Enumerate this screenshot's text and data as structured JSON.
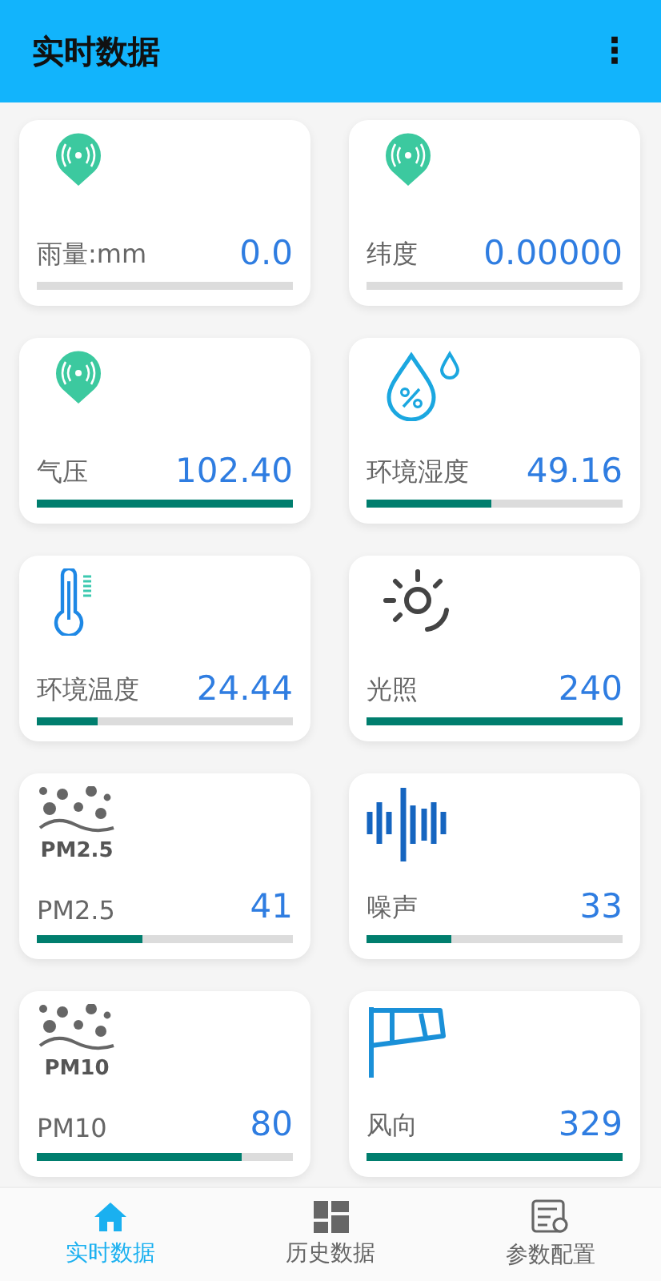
{
  "app_bar": {
    "title": "实时数据",
    "menu_icon": "⋮"
  },
  "cards": [
    {
      "kind": "pin",
      "label": "雨量:mm",
      "value": "0.0",
      "level": 0
    },
    {
      "kind": "pin",
      "label": "纬度",
      "value": "0.00000",
      "level": 0
    },
    {
      "kind": "pin",
      "label": "气压",
      "value": "102.40",
      "level": 1
    },
    {
      "kind": "humidity",
      "label": "环境湿度",
      "value": "49.16",
      "level": 0.49
    },
    {
      "kind": "thermometer",
      "label": "环境温度",
      "value": "24.44",
      "level": 0.24
    },
    {
      "kind": "sun",
      "label": "光照",
      "value": "240",
      "level": 1
    },
    {
      "kind": "particles",
      "icon_text": "PM2.5",
      "label": "PM2.5",
      "value": "41",
      "level": 0.41
    },
    {
      "kind": "sound",
      "label": "噪声",
      "value": "33",
      "level": 0.33
    },
    {
      "kind": "particles",
      "icon_text": "PM10",
      "label": "PM10",
      "value": "80",
      "level": 0.8
    },
    {
      "kind": "flag",
      "label": "风向",
      "value": "329",
      "level": 1
    }
  ],
  "bottom_nav": [
    {
      "kind": "home",
      "label": "实时数据",
      "selected": true
    },
    {
      "kind": "grid",
      "label": "历史数据",
      "selected": false
    },
    {
      "kind": "settings",
      "label": "参数配置",
      "selected": false
    }
  ]
}
